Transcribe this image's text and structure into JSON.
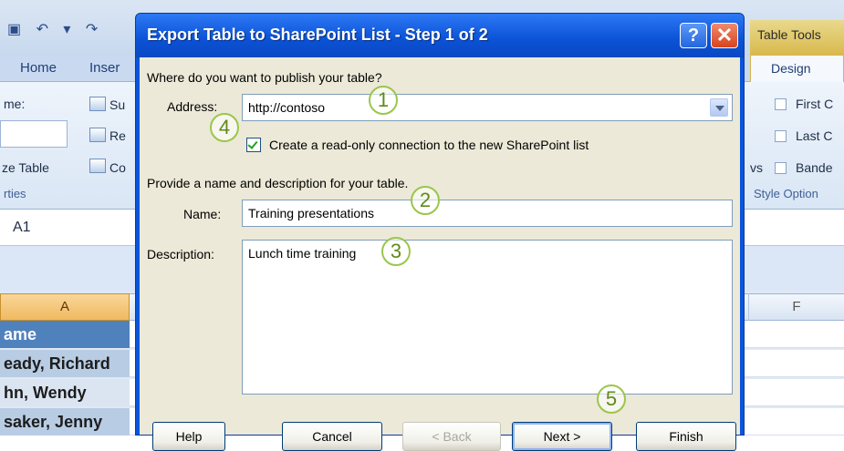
{
  "excel": {
    "tabs": {
      "home": "Home",
      "insert": "Inser",
      "design": "Design"
    },
    "contextual_tab": "Table Tools",
    "ribbon_left": {
      "name_label": "me:",
      "resize_label": "ze Table",
      "properties_group": "rties"
    },
    "ribbon_mid": {
      "item1": "Su",
      "item2": "Re",
      "item3": "Co"
    },
    "style_options": {
      "first": "First C",
      "last": "Last C",
      "banded": "Bande",
      "group_label": "Style Option",
      "partial": "vs"
    },
    "name_box": "A1",
    "column_a": "A",
    "column_f": "F",
    "cells": [
      "ame",
      "eady, Richard",
      "hn, Wendy",
      "saker, Jenny"
    ]
  },
  "dialog": {
    "title": "Export Table to SharePoint List - Step 1 of 2",
    "help": "?",
    "close": "✕",
    "question": "Where do you want to publish your table?",
    "address_label": "Address:",
    "address_value": "http://contoso",
    "readonly_checkbox": {
      "label": "Create a read-only connection to the new SharePoint list",
      "checked": true
    },
    "provide_text": "Provide a name and description for your table.",
    "name_label": "Name:",
    "name_value": "Training presentations",
    "description_label": "Description:",
    "description_value": "Lunch time training",
    "buttons": {
      "help": "Help",
      "cancel": "Cancel",
      "back": "< Back",
      "next": "Next >",
      "finish": "Finish"
    }
  },
  "callouts": [
    "1",
    "2",
    "3",
    "4",
    "5"
  ]
}
